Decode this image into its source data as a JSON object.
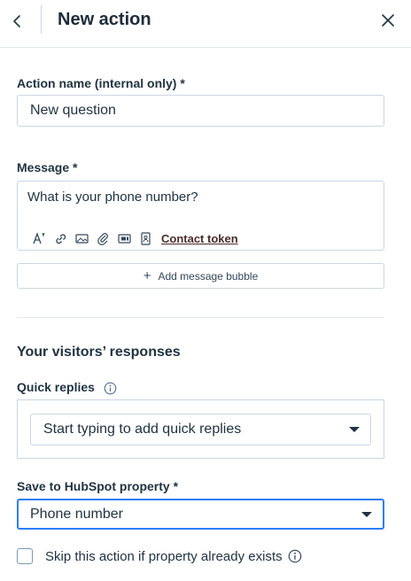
{
  "header": {
    "title": "New action"
  },
  "action_name": {
    "label": "Action name (internal only) *",
    "value": "New question"
  },
  "message": {
    "label": "Message *",
    "value": "What is your phone number?",
    "toolbar": {
      "contact_token_label": "Contact token"
    },
    "add_bubble_label": "Add message bubble"
  },
  "responses": {
    "section_title": "Your visitors’ responses",
    "quick_replies_label": "Quick replies",
    "quick_replies_placeholder": "Start typing to add quick replies"
  },
  "property": {
    "label": "Save to HubSpot property *",
    "value": "Phone number"
  },
  "skip": {
    "label": "Skip this action if property already exists",
    "checked": false
  },
  "colors": {
    "focus_border": "#2d7df6",
    "token_link": "#4a2b2b",
    "text": "#213343"
  }
}
